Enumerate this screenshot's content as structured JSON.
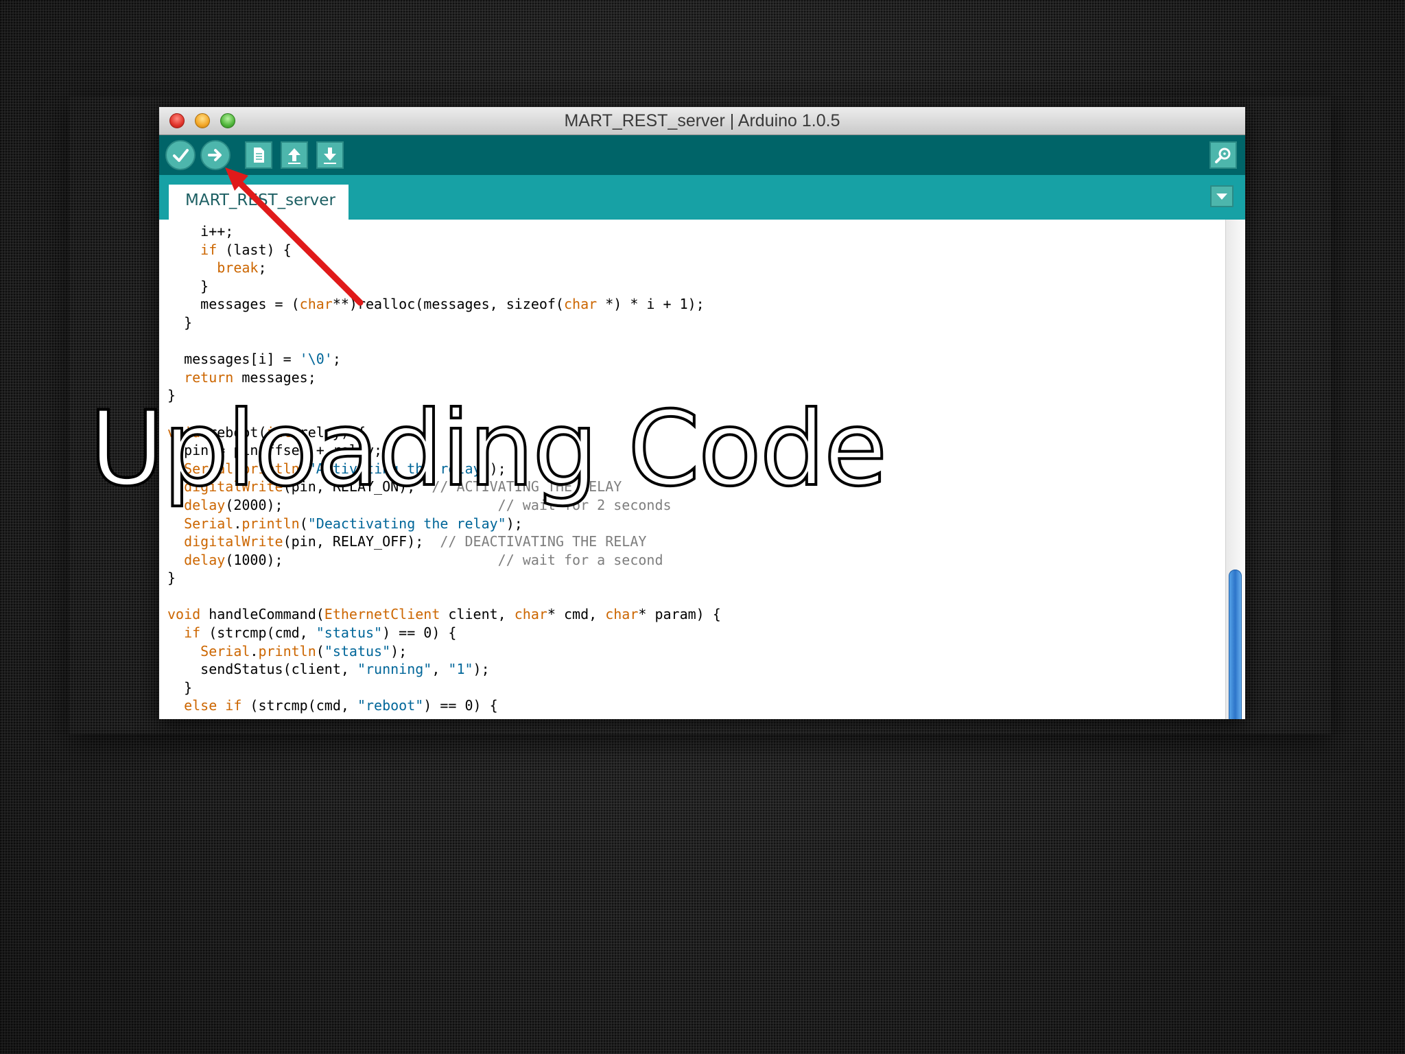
{
  "slide": {
    "title": "Uploading Code"
  },
  "window": {
    "title": "MART_REST_server | Arduino 1.0.5",
    "controls": [
      "close",
      "minimize",
      "zoom"
    ]
  },
  "toolbar": {
    "buttons": [
      {
        "name": "verify",
        "icon": "check-icon"
      },
      {
        "name": "upload",
        "icon": "right-arrow-icon"
      },
      {
        "name": "new",
        "icon": "document-icon"
      },
      {
        "name": "open",
        "icon": "up-arrow-icon"
      },
      {
        "name": "save",
        "icon": "down-arrow-icon"
      }
    ],
    "serial_monitor": {
      "icon": "magnifier-icon"
    }
  },
  "tabs": [
    {
      "label": "MART_REST_server",
      "active": true
    }
  ],
  "tab_menu": {
    "icon": "triangle-down-icon"
  },
  "annotation": {
    "color": "#e01a1a",
    "points_to": "upload"
  },
  "code": {
    "lines": [
      [
        {
          "t": "    i++;"
        }
      ],
      [
        {
          "t": "    "
        },
        {
          "t": "if",
          "c": "kw"
        },
        {
          "t": " (last) {"
        }
      ],
      [
        {
          "t": "      "
        },
        {
          "t": "break",
          "c": "kw"
        },
        {
          "t": ";"
        }
      ],
      [
        {
          "t": "    }"
        }
      ],
      [
        {
          "t": "    messages = ("
        },
        {
          "t": "char",
          "c": "kw"
        },
        {
          "t": "**)realloc(messages, sizeof("
        },
        {
          "t": "char",
          "c": "kw"
        },
        {
          "t": " *) * i + 1);"
        }
      ],
      [
        {
          "t": "  }"
        }
      ],
      [
        {
          "t": ""
        }
      ],
      [
        {
          "t": "  messages[i] = "
        },
        {
          "t": "'\\0'",
          "c": "str"
        },
        {
          "t": ";"
        }
      ],
      [
        {
          "t": "  "
        },
        {
          "t": "return",
          "c": "kw"
        },
        {
          "t": " messages;"
        }
      ],
      [
        {
          "t": "}"
        }
      ],
      [
        {
          "t": ""
        }
      ],
      [
        {
          "t": "void",
          "c": "kw"
        },
        {
          "t": " reboot("
        },
        {
          "t": "int",
          "c": "kw"
        },
        {
          "t": " relay) {"
        }
      ],
      [
        {
          "t": "  pin = pinoffset + relay;"
        }
      ],
      [
        {
          "t": "  "
        },
        {
          "t": "Serial",
          "c": "kw"
        },
        {
          "t": "."
        },
        {
          "t": "println",
          "c": "kw"
        },
        {
          "t": "("
        },
        {
          "t": "\"Activating the relay\"",
          "c": "str"
        },
        {
          "t": ");"
        }
      ],
      [
        {
          "t": "  "
        },
        {
          "t": "digitalWrite",
          "c": "kw"
        },
        {
          "t": "(pin, RELAY_ON);  "
        },
        {
          "t": "// ACTIVATING THE RELAY",
          "c": "cm"
        }
      ],
      [
        {
          "t": "  "
        },
        {
          "t": "delay",
          "c": "kw"
        },
        {
          "t": "(2000);                          "
        },
        {
          "t": "// wait for 2 seconds",
          "c": "cm"
        }
      ],
      [
        {
          "t": "  "
        },
        {
          "t": "Serial",
          "c": "kw"
        },
        {
          "t": "."
        },
        {
          "t": "println",
          "c": "kw"
        },
        {
          "t": "("
        },
        {
          "t": "\"Deactivating the relay\"",
          "c": "str"
        },
        {
          "t": ");"
        }
      ],
      [
        {
          "t": "  "
        },
        {
          "t": "digitalWrite",
          "c": "kw"
        },
        {
          "t": "(pin, RELAY_OFF);  "
        },
        {
          "t": "// DEACTIVATING THE RELAY",
          "c": "cm"
        }
      ],
      [
        {
          "t": "  "
        },
        {
          "t": "delay",
          "c": "kw"
        },
        {
          "t": "(1000);                          "
        },
        {
          "t": "// wait for a second",
          "c": "cm"
        }
      ],
      [
        {
          "t": "}"
        }
      ],
      [
        {
          "t": ""
        }
      ],
      [
        {
          "t": "void",
          "c": "kw"
        },
        {
          "t": " handleCommand("
        },
        {
          "t": "EthernetClient",
          "c": "kw"
        },
        {
          "t": " client, "
        },
        {
          "t": "char",
          "c": "kw"
        },
        {
          "t": "* cmd, "
        },
        {
          "t": "char",
          "c": "kw"
        },
        {
          "t": "* param) {"
        }
      ],
      [
        {
          "t": "  "
        },
        {
          "t": "if",
          "c": "kw"
        },
        {
          "t": " (strcmp(cmd, "
        },
        {
          "t": "\"status\"",
          "c": "str"
        },
        {
          "t": ") == 0) {"
        }
      ],
      [
        {
          "t": "    "
        },
        {
          "t": "Serial",
          "c": "kw"
        },
        {
          "t": "."
        },
        {
          "t": "println",
          "c": "kw"
        },
        {
          "t": "("
        },
        {
          "t": "\"status\"",
          "c": "str"
        },
        {
          "t": ");"
        }
      ],
      [
        {
          "t": "    sendStatus(client, "
        },
        {
          "t": "\"running\"",
          "c": "str"
        },
        {
          "t": ", "
        },
        {
          "t": "\"1\"",
          "c": "str"
        },
        {
          "t": ");"
        }
      ],
      [
        {
          "t": "  }"
        }
      ],
      [
        {
          "t": "  "
        },
        {
          "t": "else if",
          "c": "kw"
        },
        {
          "t": " (strcmp(cmd, "
        },
        {
          "t": "\"reboot\"",
          "c": "str"
        },
        {
          "t": ") == 0) {"
        }
      ]
    ]
  },
  "colors": {
    "toolbar": "#006468",
    "tabbar": "#17a1a5",
    "keyword": "#cc6600",
    "string": "#006699",
    "comment": "#7e7e7e"
  }
}
